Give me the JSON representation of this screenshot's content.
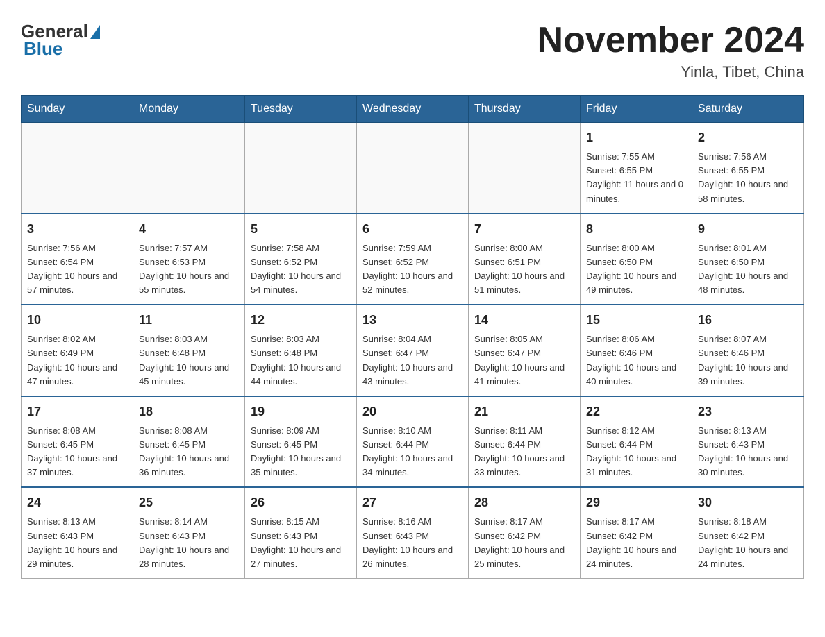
{
  "header": {
    "logo": {
      "general": "General",
      "blue": "Blue"
    },
    "title": "November 2024",
    "subtitle": "Yinla, Tibet, China"
  },
  "days_of_week": [
    "Sunday",
    "Monday",
    "Tuesday",
    "Wednesday",
    "Thursday",
    "Friday",
    "Saturday"
  ],
  "weeks": [
    [
      {
        "day": "",
        "info": ""
      },
      {
        "day": "",
        "info": ""
      },
      {
        "day": "",
        "info": ""
      },
      {
        "day": "",
        "info": ""
      },
      {
        "day": "",
        "info": ""
      },
      {
        "day": "1",
        "info": "Sunrise: 7:55 AM\nSunset: 6:55 PM\nDaylight: 11 hours and 0 minutes."
      },
      {
        "day": "2",
        "info": "Sunrise: 7:56 AM\nSunset: 6:55 PM\nDaylight: 10 hours and 58 minutes."
      }
    ],
    [
      {
        "day": "3",
        "info": "Sunrise: 7:56 AM\nSunset: 6:54 PM\nDaylight: 10 hours and 57 minutes."
      },
      {
        "day": "4",
        "info": "Sunrise: 7:57 AM\nSunset: 6:53 PM\nDaylight: 10 hours and 55 minutes."
      },
      {
        "day": "5",
        "info": "Sunrise: 7:58 AM\nSunset: 6:52 PM\nDaylight: 10 hours and 54 minutes."
      },
      {
        "day": "6",
        "info": "Sunrise: 7:59 AM\nSunset: 6:52 PM\nDaylight: 10 hours and 52 minutes."
      },
      {
        "day": "7",
        "info": "Sunrise: 8:00 AM\nSunset: 6:51 PM\nDaylight: 10 hours and 51 minutes."
      },
      {
        "day": "8",
        "info": "Sunrise: 8:00 AM\nSunset: 6:50 PM\nDaylight: 10 hours and 49 minutes."
      },
      {
        "day": "9",
        "info": "Sunrise: 8:01 AM\nSunset: 6:50 PM\nDaylight: 10 hours and 48 minutes."
      }
    ],
    [
      {
        "day": "10",
        "info": "Sunrise: 8:02 AM\nSunset: 6:49 PM\nDaylight: 10 hours and 47 minutes."
      },
      {
        "day": "11",
        "info": "Sunrise: 8:03 AM\nSunset: 6:48 PM\nDaylight: 10 hours and 45 minutes."
      },
      {
        "day": "12",
        "info": "Sunrise: 8:03 AM\nSunset: 6:48 PM\nDaylight: 10 hours and 44 minutes."
      },
      {
        "day": "13",
        "info": "Sunrise: 8:04 AM\nSunset: 6:47 PM\nDaylight: 10 hours and 43 minutes."
      },
      {
        "day": "14",
        "info": "Sunrise: 8:05 AM\nSunset: 6:47 PM\nDaylight: 10 hours and 41 minutes."
      },
      {
        "day": "15",
        "info": "Sunrise: 8:06 AM\nSunset: 6:46 PM\nDaylight: 10 hours and 40 minutes."
      },
      {
        "day": "16",
        "info": "Sunrise: 8:07 AM\nSunset: 6:46 PM\nDaylight: 10 hours and 39 minutes."
      }
    ],
    [
      {
        "day": "17",
        "info": "Sunrise: 8:08 AM\nSunset: 6:45 PM\nDaylight: 10 hours and 37 minutes."
      },
      {
        "day": "18",
        "info": "Sunrise: 8:08 AM\nSunset: 6:45 PM\nDaylight: 10 hours and 36 minutes."
      },
      {
        "day": "19",
        "info": "Sunrise: 8:09 AM\nSunset: 6:45 PM\nDaylight: 10 hours and 35 minutes."
      },
      {
        "day": "20",
        "info": "Sunrise: 8:10 AM\nSunset: 6:44 PM\nDaylight: 10 hours and 34 minutes."
      },
      {
        "day": "21",
        "info": "Sunrise: 8:11 AM\nSunset: 6:44 PM\nDaylight: 10 hours and 33 minutes."
      },
      {
        "day": "22",
        "info": "Sunrise: 8:12 AM\nSunset: 6:44 PM\nDaylight: 10 hours and 31 minutes."
      },
      {
        "day": "23",
        "info": "Sunrise: 8:13 AM\nSunset: 6:43 PM\nDaylight: 10 hours and 30 minutes."
      }
    ],
    [
      {
        "day": "24",
        "info": "Sunrise: 8:13 AM\nSunset: 6:43 PM\nDaylight: 10 hours and 29 minutes."
      },
      {
        "day": "25",
        "info": "Sunrise: 8:14 AM\nSunset: 6:43 PM\nDaylight: 10 hours and 28 minutes."
      },
      {
        "day": "26",
        "info": "Sunrise: 8:15 AM\nSunset: 6:43 PM\nDaylight: 10 hours and 27 minutes."
      },
      {
        "day": "27",
        "info": "Sunrise: 8:16 AM\nSunset: 6:43 PM\nDaylight: 10 hours and 26 minutes."
      },
      {
        "day": "28",
        "info": "Sunrise: 8:17 AM\nSunset: 6:42 PM\nDaylight: 10 hours and 25 minutes."
      },
      {
        "day": "29",
        "info": "Sunrise: 8:17 AM\nSunset: 6:42 PM\nDaylight: 10 hours and 24 minutes."
      },
      {
        "day": "30",
        "info": "Sunrise: 8:18 AM\nSunset: 6:42 PM\nDaylight: 10 hours and 24 minutes."
      }
    ]
  ]
}
